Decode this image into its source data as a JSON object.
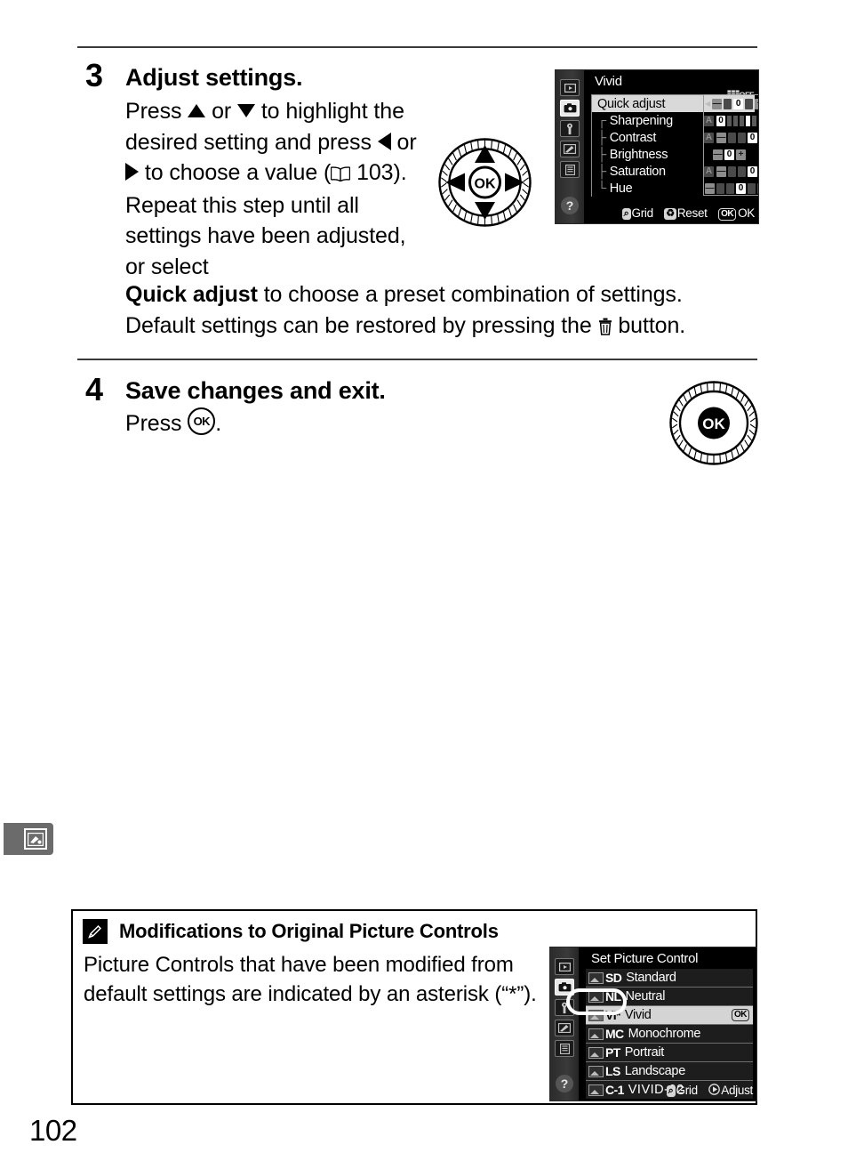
{
  "page": {
    "number": "102"
  },
  "steps": [
    {
      "number": "3",
      "title": "Adjust settings.",
      "line1_pre": "Press ",
      "line1_mid": " or ",
      "line1_post": " to highlight",
      "line2": "the desired setting and",
      "line3_pre": "press ",
      "line3_mid": " or ",
      "line3_post": " to choose a",
      "line4_pre": "value (",
      "line4_ref": "103",
      "line4_post": "). Repeat this",
      "line5": "step until all settings have",
      "line6": "been adjusted, or select",
      "line7_bold": "Quick adjust",
      "line7_rest": " to choose a preset combination of settings.",
      "line8_pre": "Default settings can be restored by pressing the ",
      "line8_post": " button."
    },
    {
      "number": "4",
      "title": "Save changes and exit.",
      "line1_pre": "Press ",
      "line1_post": "."
    }
  ],
  "dial_multi_selector": {
    "ok_label": "OK",
    "icon": "multi-selector-dial"
  },
  "dial_ok": {
    "ok_label": "OK",
    "icon": "ok-button-dial"
  },
  "lcd_picture_control": {
    "title": "Vivid",
    "off_indicator": "OFF",
    "rail_icons": [
      "playback-icon",
      "shooting-menu-icon",
      "setup-wrench-icon",
      "retouch-pencil-icon",
      "recent-settings-icon"
    ],
    "help_icon": "?",
    "rows": [
      {
        "label": "Quick adjust",
        "selected": true,
        "value": "0",
        "has_auto": false,
        "type": "plusminus-arrows"
      },
      {
        "label": "Sharpening",
        "selected": false,
        "value": "0",
        "has_auto": true,
        "type": "scale09",
        "scale_min": "0",
        "scale_max": "9"
      },
      {
        "label": "Contrast",
        "selected": false,
        "value": "0",
        "has_auto": true,
        "type": "plusminus"
      },
      {
        "label": "Brightness",
        "selected": false,
        "value": "0",
        "has_auto": false,
        "type": "plusminus-short"
      },
      {
        "label": "Saturation",
        "selected": false,
        "value": "0",
        "has_auto": true,
        "type": "plusminus"
      },
      {
        "label": "Hue",
        "selected": false,
        "value": "0",
        "has_auto": false,
        "type": "plusminus"
      }
    ],
    "footer": [
      {
        "badge": "zoom-icon",
        "badge_text": "Q",
        "label": "Grid"
      },
      {
        "badge": "trash-icon",
        "badge_text": "T",
        "label": "Reset"
      },
      {
        "badge": "ok-icon",
        "badge_text": "OK",
        "label": "OK"
      }
    ]
  },
  "lcd_set_picture_control": {
    "title": "Set Picture Control",
    "rail_icons": [
      "playback-icon",
      "shooting-menu-icon",
      "setup-wrench-icon",
      "retouch-pencil-icon",
      "recent-settings-icon"
    ],
    "help_icon": "?",
    "items": [
      {
        "code": "SD",
        "name": "Standard",
        "selected": false,
        "ok": ""
      },
      {
        "code": "NL",
        "name": "Neutral",
        "selected": false,
        "ok": ""
      },
      {
        "code": "VI*",
        "name": "Vivid",
        "selected": true,
        "ok": "OK"
      },
      {
        "code": "MC",
        "name": "Monochrome",
        "selected": false,
        "ok": ""
      },
      {
        "code": "PT",
        "name": "Portrait",
        "selected": false,
        "ok": ""
      },
      {
        "code": "LS",
        "name": "Landscape",
        "selected": false,
        "ok": ""
      },
      {
        "code": "C-1",
        "name": "VIVID-02",
        "selected": false,
        "ok": ""
      }
    ],
    "footer": [
      {
        "badge": "zoom-icon",
        "badge_text": "Q",
        "label": "Grid"
      },
      {
        "badge": "multi-selector-right-icon",
        "badge_text": "",
        "label": "Adjust"
      }
    ],
    "callout": "vivid-asterisk-callout"
  },
  "note": {
    "icon": "pencil-note-icon",
    "title": "Modifications to Original Picture Controls",
    "line1": "Picture Controls that have been modified from",
    "line2": "default settings are indicated by an asterisk (“*”)."
  },
  "margin_tab": {
    "icon": "retouch-tab-icon"
  },
  "colors": {
    "rule": "#3a3a3a",
    "lcd_background": "#000000",
    "lcd_highlight": "#d9d9d9",
    "margin_tab": "#6b6b6b"
  }
}
